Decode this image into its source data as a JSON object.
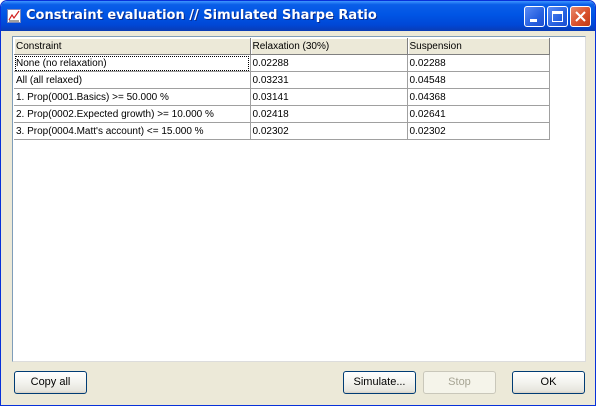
{
  "window": {
    "title": "Constraint evaluation // Simulated Sharpe Ratio"
  },
  "table": {
    "columns": [
      "Constraint",
      "Relaxation (30%)",
      "Suspension"
    ],
    "rows": [
      [
        "None (no relaxation)",
        "0.02288",
        "0.02288"
      ],
      [
        "All (all relaxed)",
        "0.03231",
        "0.04548"
      ],
      [
        "1. Prop(0001.Basics) >= 50.000 %",
        "0.03141",
        "0.04368"
      ],
      [
        "2. Prop(0002.Expected growth) >= 10.000 %",
        "0.02418",
        "0.02641"
      ],
      [
        "3. Prop(0004.Matt's account) <= 15.000 %",
        "0.02302",
        "0.02302"
      ]
    ]
  },
  "buttons": {
    "copy_all": "Copy all",
    "simulate": "Simulate...",
    "stop": "Stop",
    "ok": "OK"
  }
}
